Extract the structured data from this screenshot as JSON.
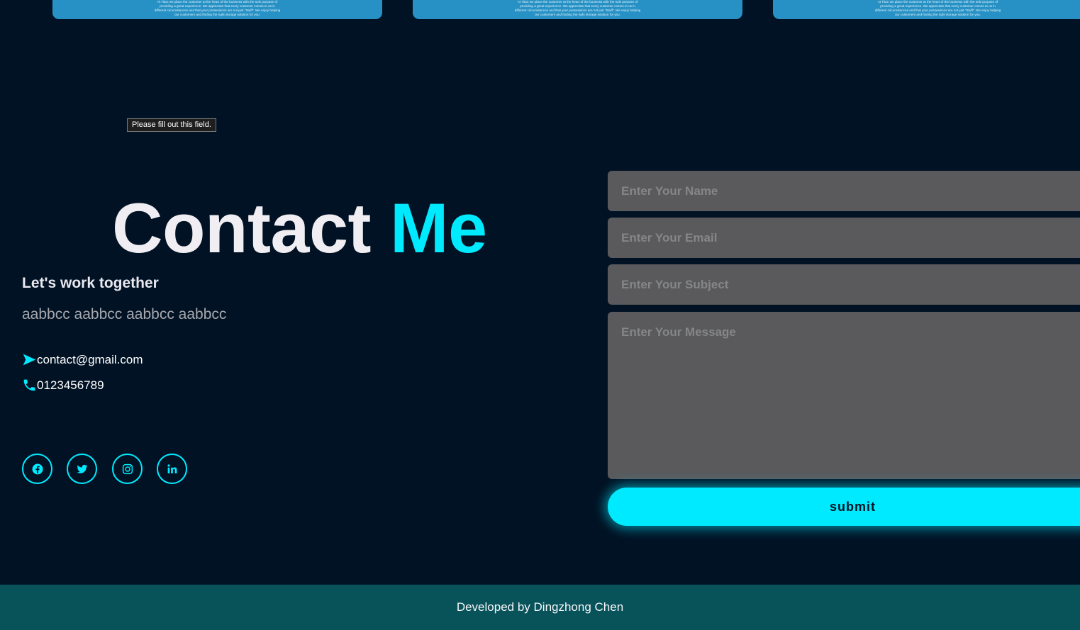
{
  "cards": [
    {
      "text": "At Titan we place the customer at the heart of the business with the sole purpose of providing a great experience. We appreciate that every customer comes to us in different circumstances and that your possessions are not just \"Stuff\". We enjoy helping our customers and finding the right storage solution for you."
    },
    {
      "text": "At Titan we place the customer at the heart of the business with the sole purpose of providing a great experience. We appreciate that every customer comes to us in different circumstances and that your possessions are not just \"Stuff\". We enjoy helping our customers and finding the right storage solution for you."
    },
    {
      "text": "At Titan we place the customer at the heart of the business with the sole purpose of providing a great experience. We appreciate that every customer comes to us in different circumstances and that your possessions are not just \"Stuff\". We enjoy helping our customers and finding the right storage solution for you."
    }
  ],
  "tooltip": "Please fill out this field.",
  "contact": {
    "title_part1": "Contact",
    "title_part2": "Me",
    "subtitle": "Let's work together",
    "description": "aabbcc aabbcc aabbcc aabbcc",
    "email": "contact@gmail.com",
    "phone": "0123456789",
    "email_icon": "send-icon",
    "phone_icon": "phone-icon"
  },
  "social": [
    {
      "icon": "facebook-icon"
    },
    {
      "icon": "twitter-icon"
    },
    {
      "icon": "instagram-icon"
    },
    {
      "icon": "linkedin-icon"
    }
  ],
  "form": {
    "name_placeholder": "Enter Your Name",
    "email_placeholder": "Enter Your Email",
    "subject_placeholder": "Enter Your Subject",
    "message_placeholder": "Enter Your Message",
    "submit_label": "submit"
  },
  "footer": {
    "credit": "Developed by Dingzhong Chen"
  },
  "colors": {
    "background": "#011224",
    "accent": "#00eaff",
    "card": "#2791c5",
    "field": "#5a5a5c",
    "footer": "#08525a"
  }
}
